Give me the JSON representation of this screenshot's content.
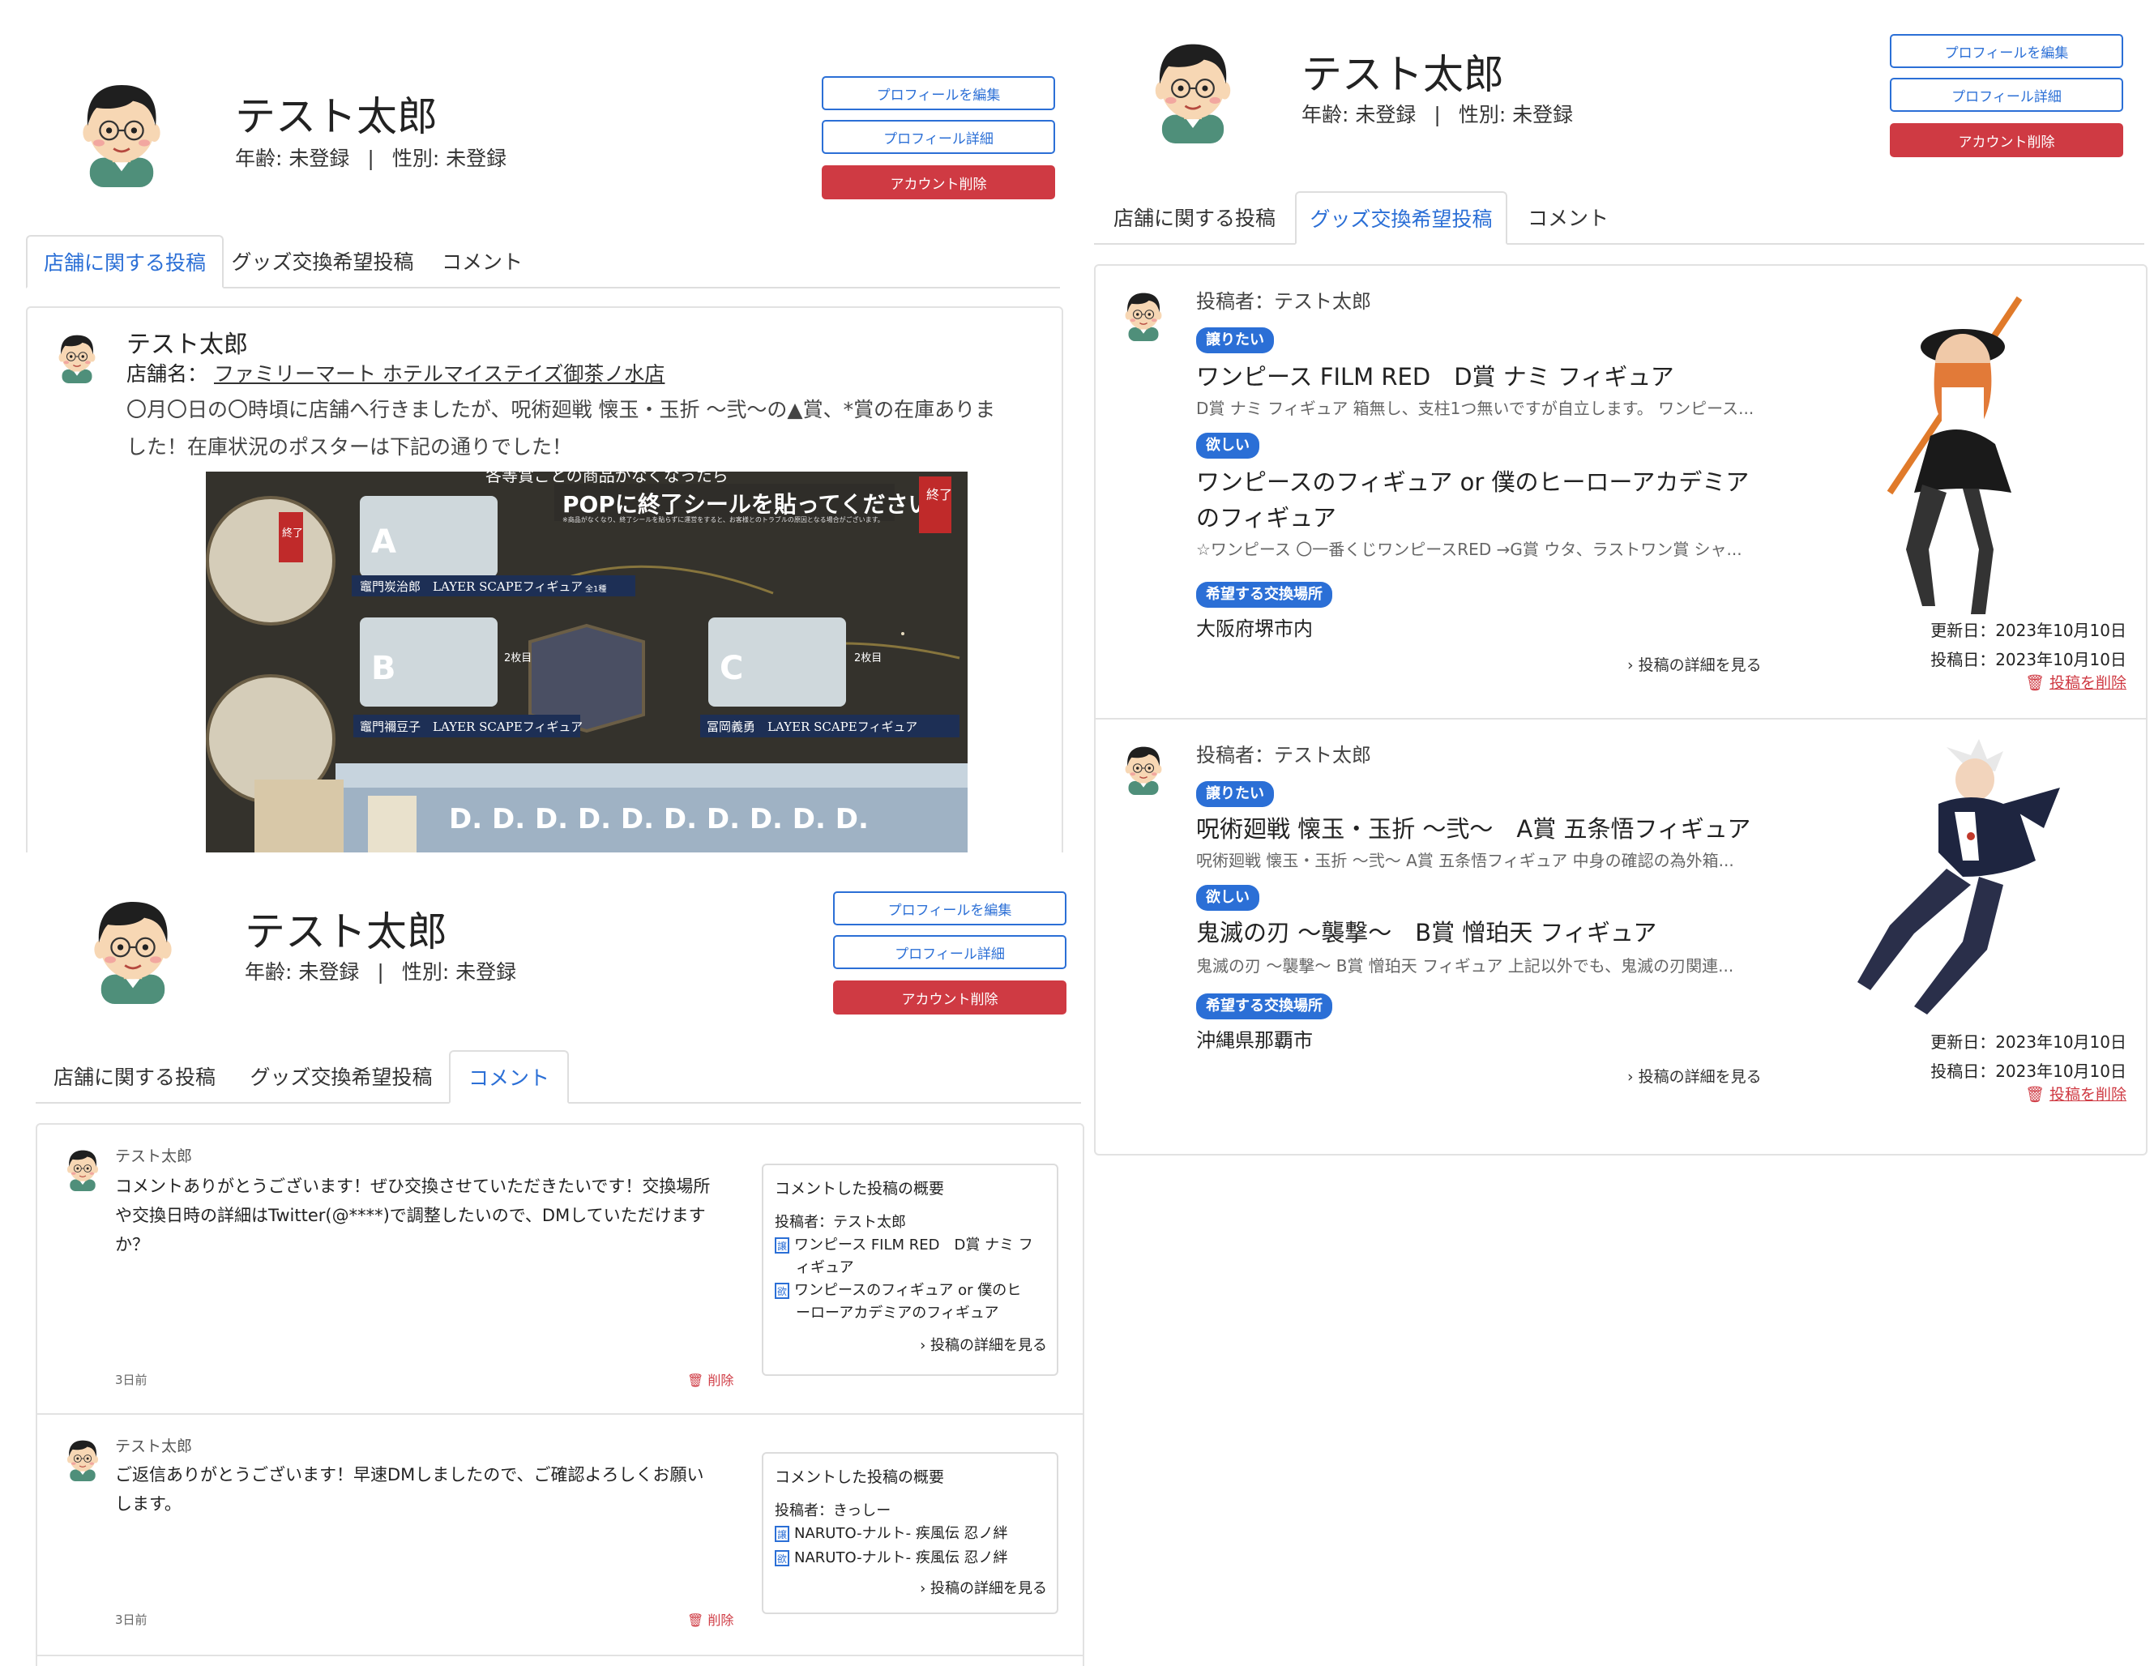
{
  "profile": {
    "name": "テスト太郎",
    "age_label": "年齢: 未登録",
    "separator": "|",
    "gender_label": "性別: 未登録"
  },
  "buttons": {
    "edit": "プロフィールを編集",
    "detail": "プロフィール詳細",
    "delete_account": "アカウント削除"
  },
  "tabs": {
    "store": "店舗に関する投稿",
    "goods": "グッズ交換希望投稿",
    "comment": "コメント"
  },
  "store_post": {
    "author": "テスト太郎",
    "store_label": "店舗名：",
    "store_name": "ファミリーマート ホテルマイステイズ御茶ノ水店",
    "body_line1": "〇月〇日の〇時頃に店舗へ行きましたが、呪術廻戦 懐玉・玉折 〜弐〜の▲賞、*賞の在庫ありま",
    "body_line2": "した！在庫状況のポスターは下記の通りでした！",
    "photo": {
      "banner_top": "各等賞ごとの商品がなくなったら",
      "banner_main": "POPに終了シールを貼ってください。",
      "banner_small": "※商品がなくなり、終了シールを貼らずに運営をすると、お客様とのトラブルの原因となる場合がございます。",
      "end_tag": "終了",
      "a_label": "竈門炭治郎　LAYER SCAPEフィギュア",
      "b_label": "竈門禰豆子　LAYER SCAPEフィギュア",
      "c_label": "冨岡義勇　LAYER SCAPEフィギュア",
      "count_tag": "全1種",
      "two_tag": "2枚目",
      "d_row": "D. D. D. D. D. D. D. D. D. D."
    }
  },
  "goods_posts": [
    {
      "author_label": "投稿者：テスト太郎",
      "give_badge": "譲りたい",
      "give_title": "ワンピース FILM RED　D賞 ナミ フィギュア",
      "give_desc": "D賞 ナミ フィギュア 箱無し、支柱1つ無いですが自立します。 ワンピース...",
      "want_badge": "欲しい",
      "want_title_line1": "ワンピースのフィギュア or 僕のヒーローアカデミア",
      "want_title_line2": "のフィギュア",
      "want_desc": "☆ワンピース 〇一番くじワンピースRED →G賞 ウタ、ラストワン賞 シャ...",
      "place_badge": "希望する交換場所",
      "place": "大阪府堺市内",
      "detail_link": "› 投稿の詳細を見る",
      "updated": "更新日：2023年10月10日",
      "posted": "投稿日：2023年10月10日",
      "delete_link": "投稿を削除"
    },
    {
      "author_label": "投稿者：テスト太郎",
      "give_badge": "譲りたい",
      "give_title": "呪術廻戦 懐玉・玉折 〜弐〜　A賞 五条悟フィギュア",
      "give_desc": "呪術廻戦 懐玉・玉折 〜弐〜 A賞 五条悟フィギュア 中身の確認の為外箱...",
      "want_badge": "欲しい",
      "want_title_line1": "鬼滅の刃 〜襲撃〜　B賞 憎珀天 フィギュア",
      "want_desc": "鬼滅の刃 〜襲撃〜 B賞 憎珀天 フィギュア 上記以外でも、鬼滅の刃関連...",
      "place_badge": "希望する交換場所",
      "place": "沖縄県那覇市",
      "detail_link": "› 投稿の詳細を見る",
      "updated": "更新日：2023年10月10日",
      "posted": "投稿日：2023年10月10日",
      "delete_link": "投稿を削除"
    }
  ],
  "comments": [
    {
      "author": "テスト太郎",
      "body_line1": "コメントありがとうございます！ぜひ交換させていただきたいです！交換場所",
      "body_line2": "や交換日時の詳細はTwitter(@****)で調整したいので、DMしていただけます",
      "body_line3": "か？",
      "time": "3日前",
      "delete": "削除",
      "summary_title": "コメントした投稿の概要",
      "summary_author": "投稿者：テスト太郎",
      "give_tag": "譲",
      "give_line1": "ワンピース FILM RED　D賞 ナミ フ",
      "give_line2": "ィギュア",
      "want_tag": "欲",
      "want_line1": "ワンピースのフィギュア or 僕のヒ",
      "want_line2": "ーローアカデミアのフィギュア",
      "summary_link": "› 投稿の詳細を見る"
    },
    {
      "author": "テスト太郎",
      "body_line1": "ご返信ありがとうございます！早速DMしましたので、ご確認よろしくお願い",
      "body_line2": "します。",
      "time": "3日前",
      "delete": "削除",
      "summary_title": "コメントした投稿の概要",
      "summary_author": "投稿者：きっしー",
      "give_tag": "譲",
      "give_line1": "NARUTO-ナルト- 疾風伝 忍ノ絆",
      "want_tag": "欲",
      "want_line1": "NARUTO-ナルト- 疾風伝 忍ノ絆",
      "summary_link": "› 投稿の詳細を見る"
    }
  ],
  "colors": {
    "accent": "#2b6fd6",
    "danger": "#cf3a43",
    "border": "#dedede"
  }
}
